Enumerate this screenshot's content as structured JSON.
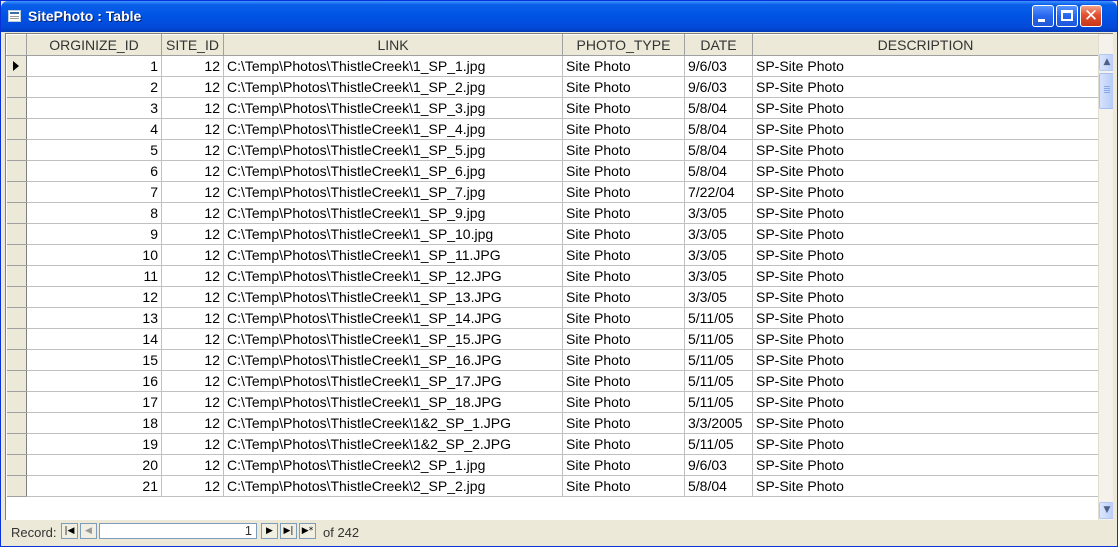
{
  "window": {
    "title": "SitePhoto : Table"
  },
  "columns": [
    "ORGINIZE_ID",
    "SITE_ID",
    "LINK",
    "PHOTO_TYPE",
    "DATE",
    "DESCRIPTION"
  ],
  "rows": [
    {
      "id": "1",
      "site": "12",
      "link": "C:\\Temp\\Photos\\ThistleCreek\\1_SP_1.jpg",
      "type": "Site Photo",
      "date": "9/6/03",
      "desc": "SP-Site Photo"
    },
    {
      "id": "2",
      "site": "12",
      "link": "C:\\Temp\\Photos\\ThistleCreek\\1_SP_2.jpg",
      "type": "Site Photo",
      "date": "9/6/03",
      "desc": "SP-Site Photo"
    },
    {
      "id": "3",
      "site": "12",
      "link": "C:\\Temp\\Photos\\ThistleCreek\\1_SP_3.jpg",
      "type": "Site Photo",
      "date": "5/8/04",
      "desc": "SP-Site Photo"
    },
    {
      "id": "4",
      "site": "12",
      "link": "C:\\Temp\\Photos\\ThistleCreek\\1_SP_4.jpg",
      "type": "Site Photo",
      "date": "5/8/04",
      "desc": "SP-Site Photo"
    },
    {
      "id": "5",
      "site": "12",
      "link": "C:\\Temp\\Photos\\ThistleCreek\\1_SP_5.jpg",
      "type": "Site Photo",
      "date": "5/8/04",
      "desc": "SP-Site Photo"
    },
    {
      "id": "6",
      "site": "12",
      "link": "C:\\Temp\\Photos\\ThistleCreek\\1_SP_6.jpg",
      "type": "Site Photo",
      "date": "5/8/04",
      "desc": "SP-Site Photo"
    },
    {
      "id": "7",
      "site": "12",
      "link": "C:\\Temp\\Photos\\ThistleCreek\\1_SP_7.jpg",
      "type": "Site Photo",
      "date": "7/22/04",
      "desc": "SP-Site Photo"
    },
    {
      "id": "8",
      "site": "12",
      "link": "C:\\Temp\\Photos\\ThistleCreek\\1_SP_9.jpg",
      "type": "Site Photo",
      "date": "3/3/05",
      "desc": "SP-Site Photo"
    },
    {
      "id": "9",
      "site": "12",
      "link": "C:\\Temp\\Photos\\ThistleCreek\\1_SP_10.jpg",
      "type": "Site Photo",
      "date": "3/3/05",
      "desc": "SP-Site Photo"
    },
    {
      "id": "10",
      "site": "12",
      "link": "C:\\Temp\\Photos\\ThistleCreek\\1_SP_11.JPG",
      "type": "Site Photo",
      "date": "3/3/05",
      "desc": "SP-Site Photo"
    },
    {
      "id": "11",
      "site": "12",
      "link": "C:\\Temp\\Photos\\ThistleCreek\\1_SP_12.JPG",
      "type": "Site Photo",
      "date": "3/3/05",
      "desc": "SP-Site Photo"
    },
    {
      "id": "12",
      "site": "12",
      "link": "C:\\Temp\\Photos\\ThistleCreek\\1_SP_13.JPG",
      "type": "Site Photo",
      "date": "3/3/05",
      "desc": "SP-Site Photo"
    },
    {
      "id": "13",
      "site": "12",
      "link": "C:\\Temp\\Photos\\ThistleCreek\\1_SP_14.JPG",
      "type": "Site Photo",
      "date": "5/11/05",
      "desc": "SP-Site Photo"
    },
    {
      "id": "14",
      "site": "12",
      "link": "C:\\Temp\\Photos\\ThistleCreek\\1_SP_15.JPG",
      "type": "Site Photo",
      "date": "5/11/05",
      "desc": "SP-Site Photo"
    },
    {
      "id": "15",
      "site": "12",
      "link": "C:\\Temp\\Photos\\ThistleCreek\\1_SP_16.JPG",
      "type": "Site Photo",
      "date": "5/11/05",
      "desc": "SP-Site Photo"
    },
    {
      "id": "16",
      "site": "12",
      "link": "C:\\Temp\\Photos\\ThistleCreek\\1_SP_17.JPG",
      "type": "Site Photo",
      "date": "5/11/05",
      "desc": "SP-Site Photo"
    },
    {
      "id": "17",
      "site": "12",
      "link": "C:\\Temp\\Photos\\ThistleCreek\\1_SP_18.JPG",
      "type": "Site Photo",
      "date": "5/11/05",
      "desc": "SP-Site Photo"
    },
    {
      "id": "18",
      "site": "12",
      "link": "C:\\Temp\\Photos\\ThistleCreek\\1&2_SP_1.JPG",
      "type": "Site Photo",
      "date": "3/3/2005",
      "desc": "SP-Site Photo"
    },
    {
      "id": "19",
      "site": "12",
      "link": "C:\\Temp\\Photos\\ThistleCreek\\1&2_SP_2.JPG",
      "type": "Site Photo",
      "date": "5/11/05",
      "desc": "SP-Site Photo"
    },
    {
      "id": "20",
      "site": "12",
      "link": "C:\\Temp\\Photos\\ThistleCreek\\2_SP_1.jpg",
      "type": "Site Photo",
      "date": "9/6/03",
      "desc": "SP-Site Photo"
    },
    {
      "id": "21",
      "site": "12",
      "link": "C:\\Temp\\Photos\\ThistleCreek\\2_SP_2.jpg",
      "type": "Site Photo",
      "date": "5/8/04",
      "desc": "SP-Site Photo"
    }
  ],
  "navigation": {
    "label": "Record:",
    "current": "1",
    "of_text": "of 242"
  },
  "icons": {
    "first": "first-record-icon",
    "prev": "previous-record-icon",
    "next": "next-record-icon",
    "last": "last-record-icon",
    "new": "new-record-icon",
    "pointer": "row-pointer-icon"
  },
  "colors": {
    "titlebar": "#0055e5",
    "close_button": "#e1502e",
    "chrome": "#ece9d8"
  }
}
